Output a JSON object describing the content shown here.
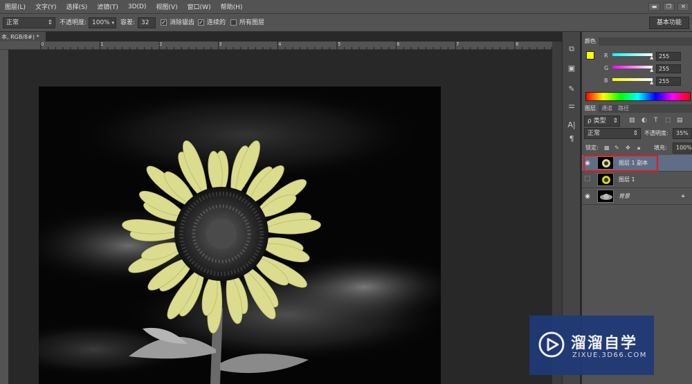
{
  "menubar": {
    "items": [
      "图层(L)",
      "文字(Y)",
      "选择(S)",
      "滤镜(T)",
      "3D(D)",
      "视图(V)",
      "窗口(W)",
      "帮助(H)"
    ]
  },
  "options": {
    "mode_value": "正常",
    "opacity_label": "不透明度:",
    "opacity_value": "100%",
    "tolerance_label": "容差:",
    "tolerance_value": "32",
    "antialias_label": "消除锯齿",
    "contiguous_label": "连续的",
    "all_layers_label": "所有图层",
    "workspace_label": "基本功能"
  },
  "document": {
    "tab_label": "本, RGB/8#) *"
  },
  "ruler": {
    "labels": [
      "0",
      "1",
      "2",
      "3",
      "4",
      "5",
      "6",
      "7",
      "8"
    ]
  },
  "panels": {
    "color_tab": "颜色",
    "color": {
      "fg_color": "#ffff00",
      "bg_color": "#ffffff",
      "channels": [
        {
          "label": "R",
          "value": "255",
          "gradient": "linear-gradient(90deg,#00ffff,#ffffff)"
        },
        {
          "label": "G",
          "value": "255",
          "gradient": "linear-gradient(90deg,#ff00ff,#ffffff)"
        },
        {
          "label": "B",
          "value": "255",
          "gradient": "linear-gradient(90deg,#ffff00,#ffffff)"
        }
      ]
    },
    "layers_tabs": [
      "图层",
      "通道",
      "路径"
    ],
    "layers": {
      "filter_label": "ρ 类型",
      "blend_mode": "正常",
      "opacity_label": "不透明度:",
      "opacity_value": "35%",
      "lock_label": "锁定:",
      "fill_label": "填充:",
      "fill_value": "100%",
      "items": [
        {
          "name": "图层 1 副本",
          "visible": true,
          "selected": true
        },
        {
          "name": "图层 1",
          "visible": false,
          "selected": false
        },
        {
          "name": "背景",
          "visible": true,
          "selected": false,
          "locked": true
        }
      ]
    }
  },
  "watermark": {
    "title": "溜溜自学",
    "url": "ZIXUE.3D66.COM"
  }
}
